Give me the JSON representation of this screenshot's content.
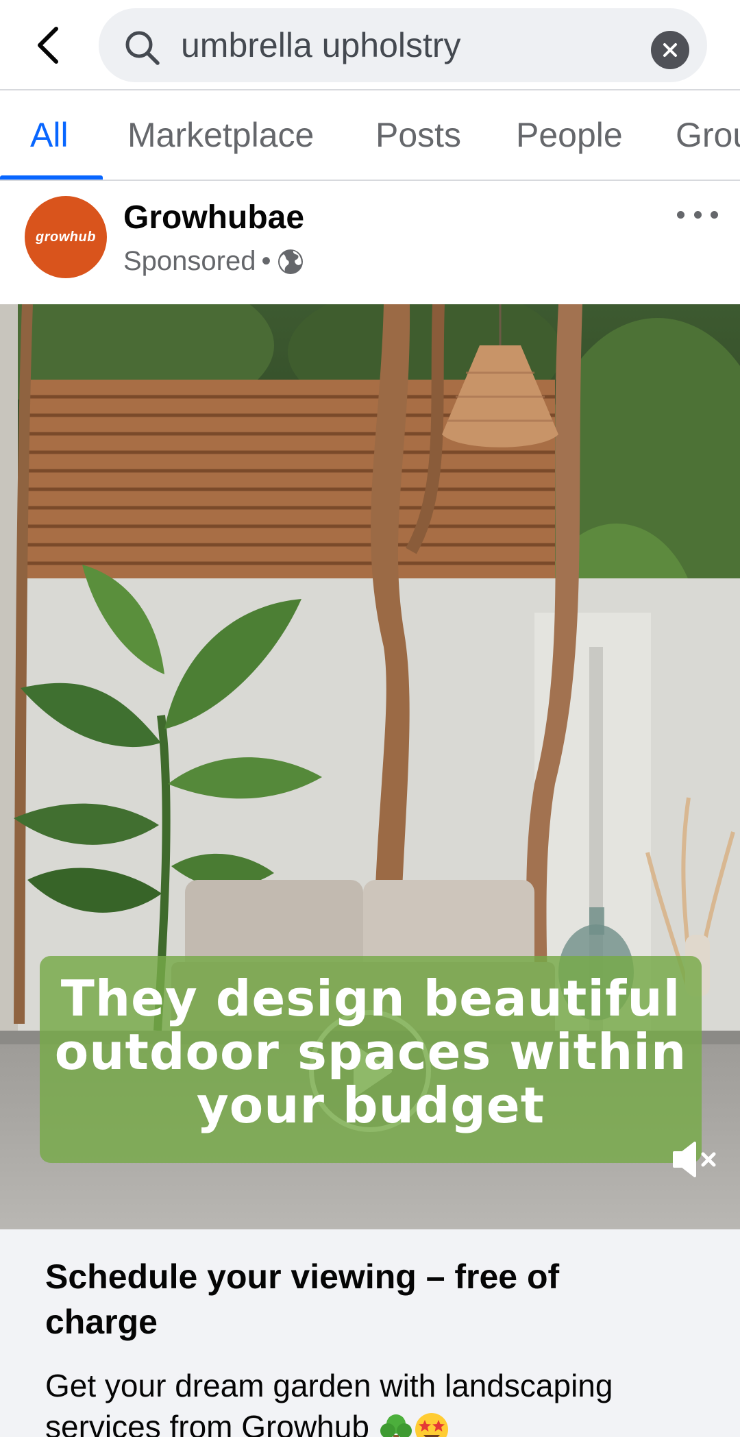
{
  "search": {
    "query": "umbrella upholstry"
  },
  "tabs": [
    {
      "label": "All",
      "active": true
    },
    {
      "label": "Marketplace",
      "active": false
    },
    {
      "label": "Posts",
      "active": false
    },
    {
      "label": "People",
      "active": false
    },
    {
      "label": "Grou",
      "active": false
    }
  ],
  "post": {
    "avatar_text": "growhub",
    "page_name": "Growhubae",
    "sponsored_label": "Sponsored",
    "separator": "•",
    "video_caption": [
      "They design beautiful",
      "outdoor spaces within",
      "your budget"
    ],
    "cta_title": "Schedule your viewing – free of charge",
    "cta_description": "Get your dream garden with landscaping services from Growhub"
  },
  "colors": {
    "accent": "#0866ff",
    "avatar_bg": "#d9541c",
    "caption_bg": "#76aa48",
    "secondary_text": "#65676b"
  },
  "icons": {
    "back": "chevron-left-icon",
    "search": "search-icon",
    "clear": "close-circle-icon",
    "privacy": "globe-icon",
    "more": "more-horizontal-icon",
    "play": "play-icon",
    "mute": "speaker-muted-icon",
    "emoji": [
      "tree-emoji",
      "star-struck-emoji"
    ]
  }
}
